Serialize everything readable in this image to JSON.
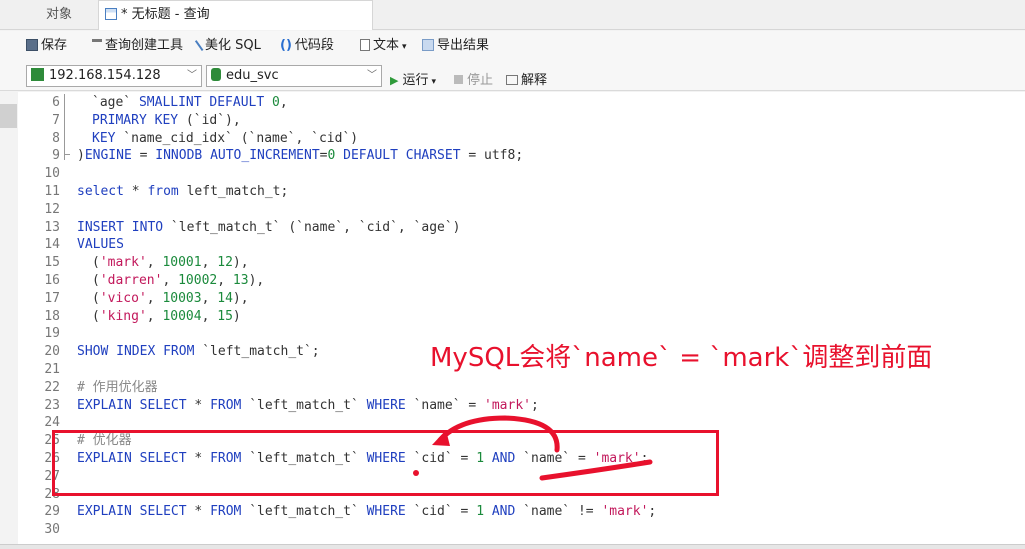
{
  "tabs": {
    "objects_label": "对象",
    "query_label": "* 无标题 - 查询"
  },
  "toolbar": {
    "save": "保存",
    "query_builder": "查询创建工具",
    "beautify": "美化 SQL",
    "snippet": "代码段",
    "text": "文本",
    "export": "导出结果"
  },
  "connection": {
    "host": "192.168.154.128",
    "database": "edu_svc",
    "run": "运行",
    "stop": "停止",
    "explain": "解释"
  },
  "editor": {
    "lines": [
      {
        "n": "6"
      },
      {
        "n": "7"
      },
      {
        "n": "8"
      },
      {
        "n": "9"
      },
      {
        "n": "10"
      },
      {
        "n": "11"
      },
      {
        "n": "12"
      },
      {
        "n": "13"
      },
      {
        "n": "14"
      },
      {
        "n": "15"
      },
      {
        "n": "16"
      },
      {
        "n": "17"
      },
      {
        "n": "18"
      },
      {
        "n": "19"
      },
      {
        "n": "20"
      },
      {
        "n": "21"
      },
      {
        "n": "22"
      },
      {
        "n": "23"
      },
      {
        "n": "24"
      },
      {
        "n": "25"
      },
      {
        "n": "26"
      },
      {
        "n": "27"
      },
      {
        "n": "28"
      },
      {
        "n": "29"
      },
      {
        "n": "30"
      }
    ],
    "code": {
      "l6": "`age` SMALLINT DEFAULT 0,",
      "l7": "PRIMARY KEY (`id`),",
      "l8": "KEY `name_cid_idx` (`name`, `cid`)",
      "l9": ")ENGINE = INNODB AUTO_INCREMENT=0 DEFAULT CHARSET = utf8;",
      "l11": "select * from left_match_t;",
      "l13": "INSERT INTO `left_match_t` (`name`, `cid`, `age`)",
      "l14": "VALUES",
      "l15": "('mark', 10001, 12),",
      "l16": "('darren', 10002, 13),",
      "l17": "('vico', 10003, 14),",
      "l18": "('king', 10004, 15)",
      "l20": "SHOW INDEX FROM `left_match_t`;",
      "l22": "# 作用优化器",
      "l23": "EXPLAIN SELECT * FROM `left_match_t` WHERE `name` = 'mark';",
      "l25": "# 优化器",
      "l26": "EXPLAIN SELECT * FROM `left_match_t` WHERE `cid` = 1 AND `name` = 'mark';",
      "l29": "EXPLAIN SELECT * FROM `left_match_t` WHERE `cid` = 1 AND `name` != 'mark';"
    }
  },
  "annotation": {
    "text": "MySQL会将`name` = `mark`调整到前面",
    "color": "#e8112d"
  }
}
